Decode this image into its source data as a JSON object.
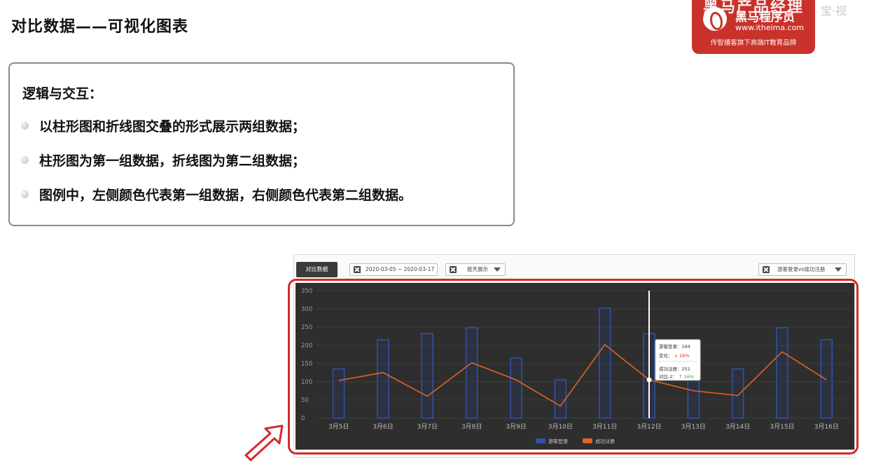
{
  "slide": {
    "title": "对比数据——可视化图表",
    "logic_heading": "逻辑与交互：",
    "bullets": [
      "以柱形图和折线图交叠的形式展示两组数据；",
      "柱形图为第一组数据，折线图为第二组数据；",
      "图例中，左侧颜色代表第一组数据，右侧颜色代表第二组数据。"
    ]
  },
  "logo": {
    "top_text": "黑马产品经理",
    "brand": "黑马程序员",
    "url": "www.itheima.com",
    "slogan": "传智播客旗下高端IT教育品牌"
  },
  "overlay_text": "宝·视",
  "widget": {
    "tab_label": "对比数据",
    "date_range": "2020-03-05 ~ 2020-03-17",
    "display_mode": "按天展示",
    "compare_select": "游客登录vs成功注册"
  },
  "colors": {
    "bar": "#2f54a8",
    "line": "#e0641e",
    "chart_bg": "#2e2e2e",
    "frame": "#d42a2a"
  },
  "chart_data": {
    "type": "bar",
    "categories": [
      "3月5日",
      "3月6日",
      "3月7日",
      "3月8日",
      "3月9日",
      "3月10日",
      "3月11日",
      "3月12日",
      "3月13日",
      "3月14日",
      "3月15日",
      "3月16日"
    ],
    "series": [
      {
        "name": "游客登录",
        "type": "bar",
        "values": [
          135,
          215,
          232,
          248,
          165,
          105,
          302,
          232,
          132,
          135,
          248,
          215
        ]
      },
      {
        "name": "成功注册",
        "type": "line",
        "values": [
          103,
          125,
          60,
          152,
          105,
          33,
          202,
          105,
          75,
          62,
          182,
          105
        ]
      }
    ],
    "ylim": [
      0,
      350
    ],
    "yticks": [
      0,
      50,
      100,
      150,
      200,
      250,
      300,
      350
    ],
    "legend_position": "bottom",
    "hover_index": 7,
    "tooltip": {
      "rows": [
        {
          "label": "游客登录：",
          "value": "164"
        },
        {
          "label": "变化：",
          "arrow": "↓",
          "value": "16%"
        },
        {
          "label": "成功注册：",
          "value": "251"
        },
        {
          "label": "对比-2：",
          "arrow": "↑",
          "value": "16%"
        }
      ]
    }
  }
}
